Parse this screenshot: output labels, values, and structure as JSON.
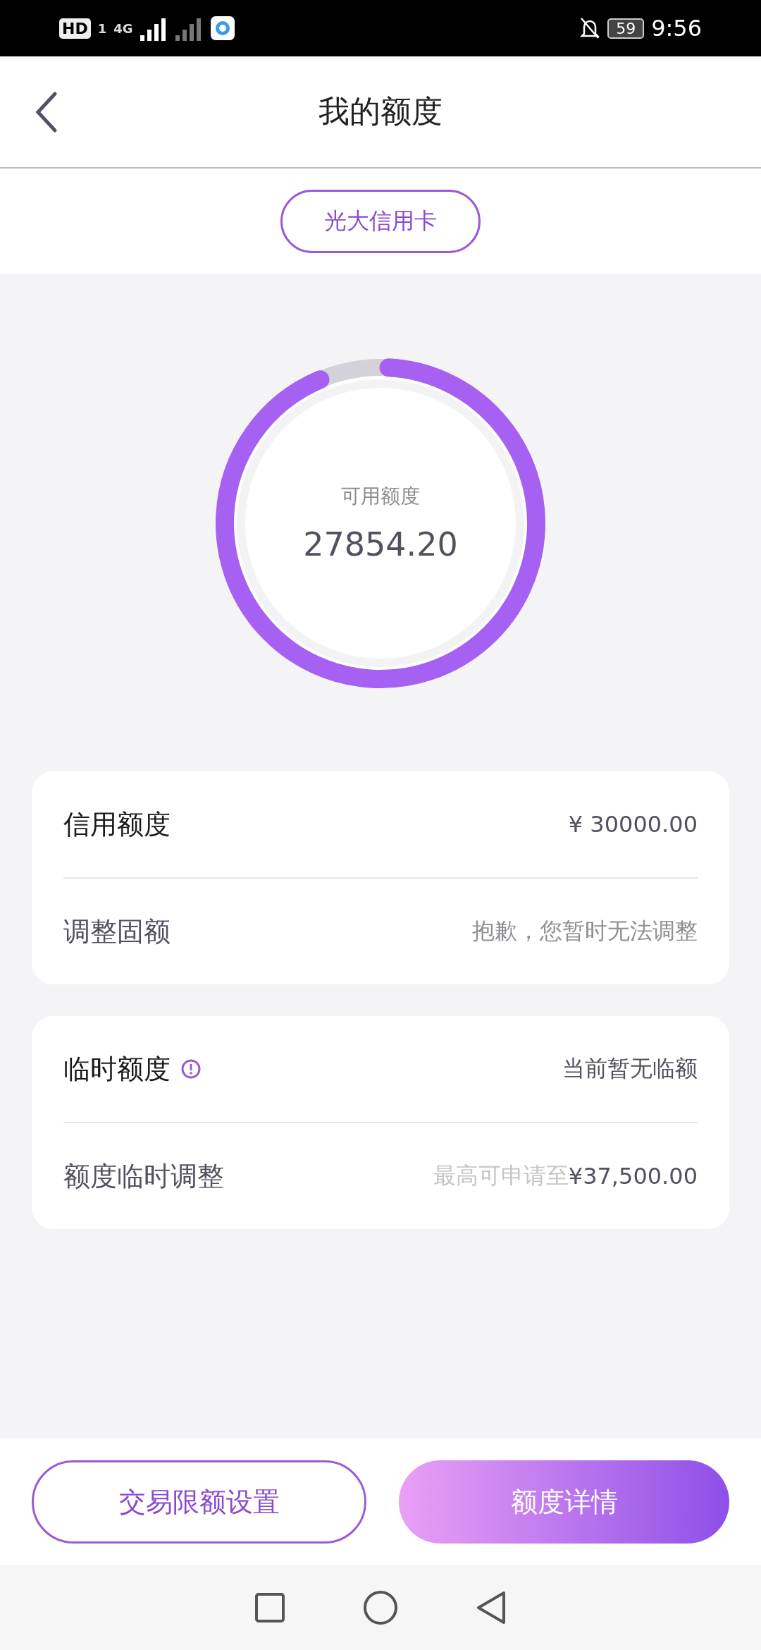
{
  "status_bar": {
    "hd": "HD",
    "sim": "1",
    "network": "4G",
    "battery": "59",
    "time": "9:56"
  },
  "header": {
    "title": "我的额度"
  },
  "card_tab": {
    "label": "光大信用卡",
    "selected": true
  },
  "gauge": {
    "label": "可用额度",
    "value": "27854.20",
    "level": 0.928
  },
  "sections": [
    {
      "rows": [
        {
          "label": "信用额度",
          "value": "¥ 30000.00",
          "info": false
        },
        {
          "label": "调整固额",
          "value": "抱歉，您暂时无法调整",
          "muted": true,
          "info": false
        }
      ]
    },
    {
      "rows": [
        {
          "label": "临时额度",
          "value": "当前暂无临额",
          "info": true
        },
        {
          "label": "额度临时调整",
          "note": "最高可申请至",
          "value": "¥37,500.00",
          "info": false
        }
      ]
    }
  ],
  "buttons": [
    {
      "label": "交易限额设置",
      "kind": "outline"
    },
    {
      "label": "额度详情",
      "kind": "filled"
    }
  ]
}
